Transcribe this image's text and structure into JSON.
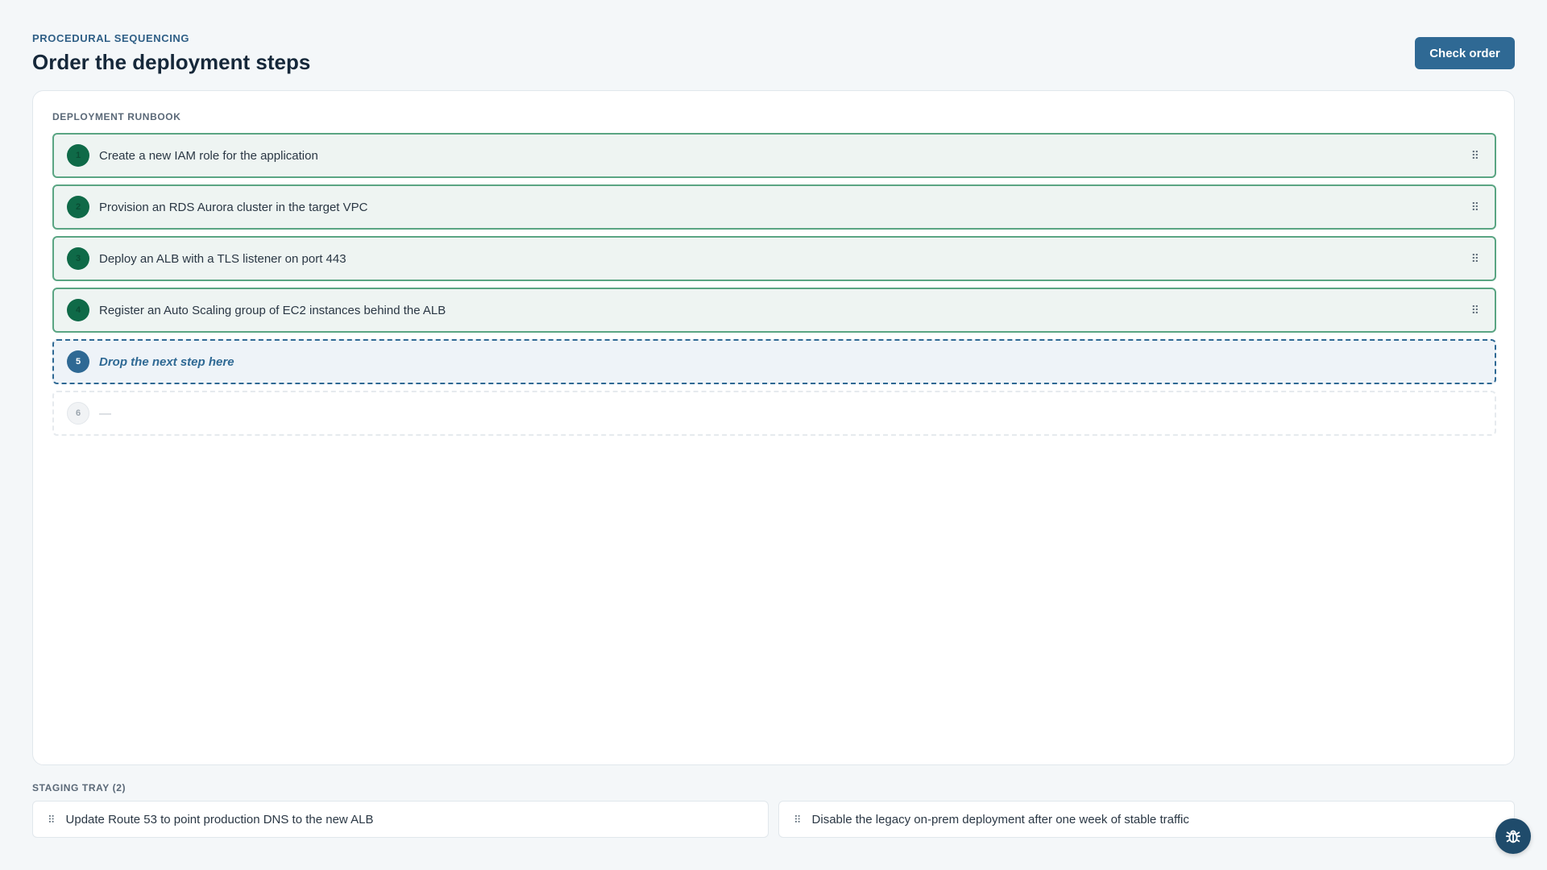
{
  "header": {
    "eyebrow": "PROCEDURAL SEQUENCING",
    "title": "Order the deployment steps",
    "check_button": "Check order"
  },
  "runbook": {
    "label": "DEPLOYMENT RUNBOOK",
    "steps": [
      {
        "number": "1",
        "text": "Create a new IAM role for the application",
        "state": "placed"
      },
      {
        "number": "2",
        "text": "Provision an RDS Aurora cluster in the target VPC",
        "state": "placed"
      },
      {
        "number": "3",
        "text": "Deploy an ALB with a TLS listener on port 443",
        "state": "placed"
      },
      {
        "number": "4",
        "text": "Register an Auto Scaling group of EC2 instances behind the ALB",
        "state": "placed"
      },
      {
        "number": "5",
        "text": "Drop the next step here",
        "state": "target"
      },
      {
        "number": "6",
        "text": "—",
        "state": "empty"
      }
    ]
  },
  "tray": {
    "label": "STAGING TRAY (2)",
    "items": [
      {
        "text": "Update Route 53 to point production DNS to the new ALB"
      },
      {
        "text": "Disable the legacy on-prem deployment after one week of stable traffic"
      }
    ]
  },
  "icons": {
    "drag_handle": "grip-vertical-icon",
    "debug": "bug-icon"
  },
  "colors": {
    "accent": "#2f6994",
    "placed_badge": "#0f6a48",
    "placed_border": "#5aa583",
    "background": "#f4f7f9"
  }
}
